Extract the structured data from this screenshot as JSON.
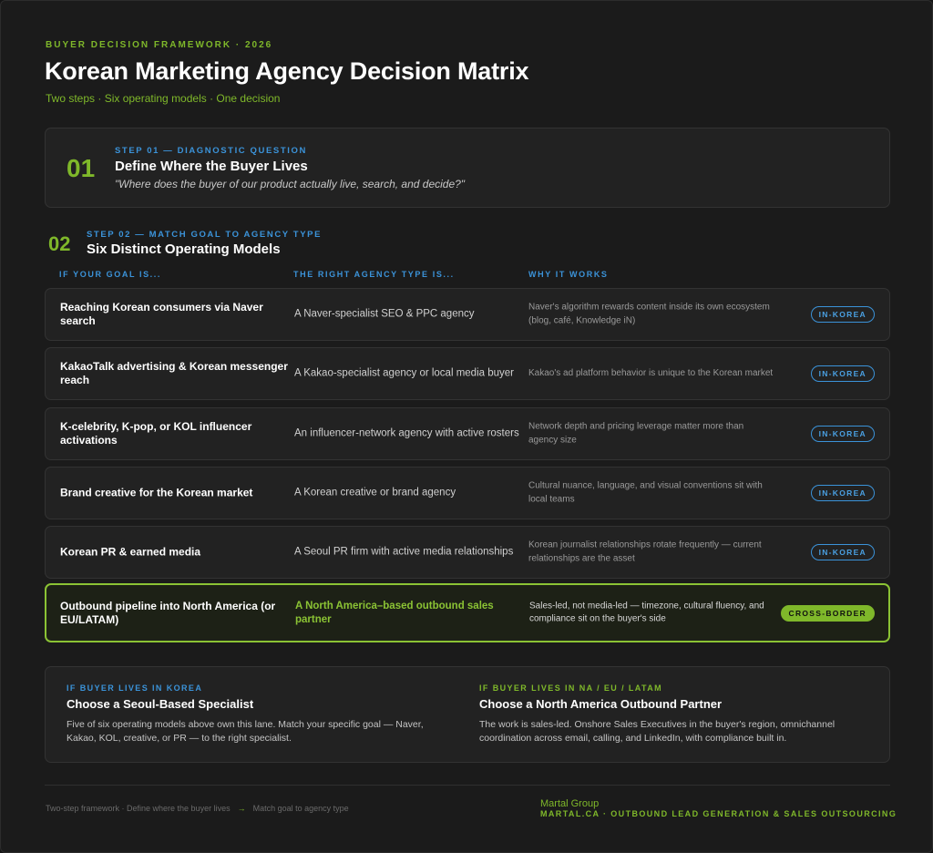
{
  "header": {
    "eyebrow": "BUYER DECISION FRAMEWORK · 2026",
    "title": "Korean Marketing Agency Decision Matrix",
    "subtitle": "Two steps · Six operating models · One decision"
  },
  "step1": {
    "number": "01",
    "eyebrow": "STEP 01 — DIAGNOSTIC QUESTION",
    "title": "Define Where the Buyer Lives",
    "quote": "\"Where does the buyer of our product actually live, search, and decide?\""
  },
  "step2": {
    "number": "02",
    "eyebrow": "STEP 02 — MATCH GOAL TO AGENCY TYPE",
    "title": "Six Distinct Operating Models",
    "columns": {
      "goal": "IF YOUR GOAL IS...",
      "agency": "THE RIGHT AGENCY TYPE IS...",
      "why": "WHY IT WORKS"
    },
    "rows": [
      {
        "goal": "Reaching Korean consumers via Naver search",
        "agency": "A Naver-specialist SEO & PPC agency",
        "why": "Naver's algorithm rewards content inside its own ecosystem (blog, café, Knowledge iN)",
        "badge": "IN-KOREA"
      },
      {
        "goal": "KakaoTalk advertising & Korean messenger reach",
        "agency": "A Kakao-specialist agency or local media buyer",
        "why": "Kakao's ad platform behavior is unique to the Korean market",
        "badge": "IN-KOREA"
      },
      {
        "goal": "K-celebrity, K-pop, or KOL influencer activations",
        "agency": "An influencer-network agency with active rosters",
        "why": "Network depth and pricing leverage matter more than agency size",
        "badge": "IN-KOREA"
      },
      {
        "goal": "Brand creative for the Korean market",
        "agency": "A Korean creative or brand agency",
        "why": "Cultural nuance, language, and visual conventions sit with local teams",
        "badge": "IN-KOREA"
      },
      {
        "goal": "Korean PR & earned media",
        "agency": "A Seoul PR firm with active media relationships",
        "why": "Korean journalist relationships rotate frequently — current relationships are the asset",
        "badge": "IN-KOREA"
      },
      {
        "goal": "Outbound pipeline into North America (or EU/LATAM)",
        "agency": "A North America–based outbound sales partner",
        "why": "Sales-led, not media-led — timezone, cultural fluency, and compliance sit on the buyer's side",
        "badge": "CROSS-BORDER"
      }
    ]
  },
  "outcomes": {
    "korea": {
      "eyebrow": "IF BUYER LIVES IN KOREA",
      "title": "Choose a Seoul-Based Specialist",
      "body": "Five of six operating models above own this lane. Match your specific goal — Naver, Kakao, KOL, creative, or PR — to the right specialist."
    },
    "abroad": {
      "eyebrow": "IF BUYER LIVES IN NA / EU / LATAM",
      "title": "Choose a North America Outbound Partner",
      "body": "The work is sales-led. Onshore Sales Executives in the buyer's region, omnichannel coordination across email, calling, and LinkedIn, with compliance built in."
    }
  },
  "footer": {
    "left_a": "Two-step framework · Define where the buyer lives",
    "arrow": "→",
    "left_b": "Match goal to agency type",
    "brand": "Martal Group",
    "brand_sub": "MARTAL.CA · OUTBOUND LEAD GENERATION & SALES OUTSOURCING"
  },
  "colors": {
    "accent_green": "#7fb82a",
    "accent_blue": "#3b93d9",
    "background": "#1b1b1b"
  }
}
